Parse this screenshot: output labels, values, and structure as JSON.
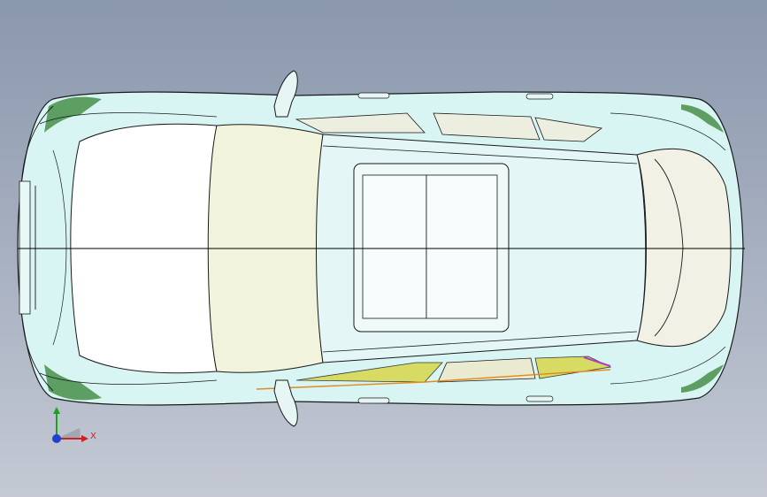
{
  "viewport": {
    "background_top": "#8a97ad",
    "background_bottom": "#c4c9d4",
    "model_name": "car-body-top-view"
  },
  "model": {
    "body_fill": "#d8f5f3",
    "edge_color": "#1a1a1a",
    "hood_fill": "#ffffff",
    "windshield_fill": "#f2f3dc",
    "roof_fill": "#e4f7f6",
    "sunroof_fill": "#eef9f8",
    "light_green": "#3e8a3e",
    "window_yellow": "#d7d64a",
    "trim_orange": "#e08a20",
    "accent_magenta": "#b040c0",
    "centerline_color": "#000000"
  },
  "triad": {
    "x_label": "X",
    "x_color": "#d02020",
    "y_color": "#20a020",
    "z_color": "#2040d0",
    "icon": "coordinate-triad-icon"
  }
}
